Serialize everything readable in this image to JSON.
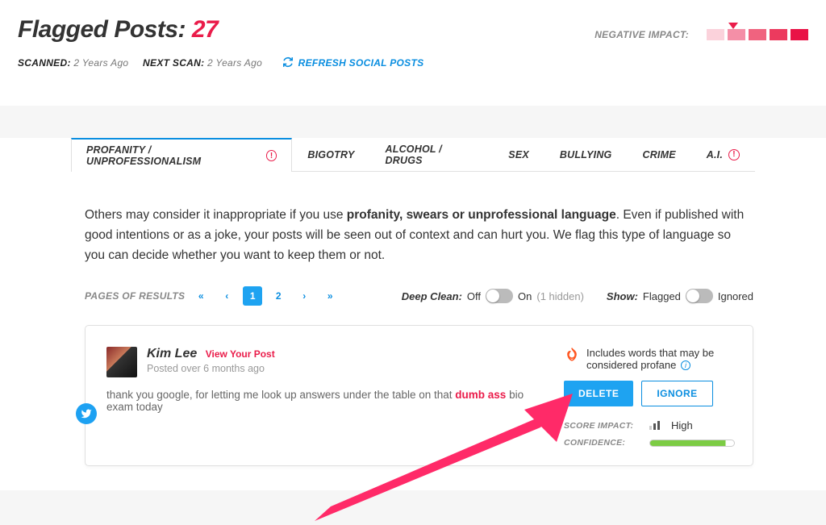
{
  "header": {
    "title_label": "Flagged Posts:",
    "count": "27",
    "scanned_label": "SCANNED:",
    "scanned_value": "2 Years Ago",
    "nextscan_label": "NEXT SCAN:",
    "nextscan_value": "2 Years Ago",
    "refresh": "REFRESH SOCIAL POSTS"
  },
  "impact": {
    "label": "NEGATIVE IMPACT:",
    "colors": [
      "#fbd2db",
      "#f48fa7",
      "#f0637f",
      "#ec3a5e",
      "#e91246"
    ],
    "pointer_index": 1
  },
  "tabs": [
    {
      "label": "PROFANITY / UNPROFESSIONALISM",
      "alert": true,
      "active": true
    },
    {
      "label": "BIGOTRY",
      "alert": false,
      "active": false
    },
    {
      "label": "ALCOHOL / DRUGS",
      "alert": false,
      "active": false
    },
    {
      "label": "SEX",
      "alert": false,
      "active": false
    },
    {
      "label": "BULLYING",
      "alert": false,
      "active": false
    },
    {
      "label": "CRIME",
      "alert": false,
      "active": false
    },
    {
      "label": "A.I.",
      "alert": true,
      "active": false
    }
  ],
  "description": {
    "pre": "Others may consider it inappropriate if you use ",
    "bold": "profanity, swears or unprofessional language",
    "post": ". Even if published with good intentions or as a joke, your posts will be seen out of context and can hurt you. We flag this type of language so you can decide whether you want to keep them or not."
  },
  "pager": {
    "label": "PAGES OF RESULTS",
    "pages": [
      "1",
      "2"
    ],
    "active": "1"
  },
  "controls": {
    "deepclean_label": "Deep Clean:",
    "off": "Off",
    "on": "On",
    "hidden": "(1 hidden)",
    "show_label": "Show:",
    "flagged": "Flagged",
    "ignored": "Ignored"
  },
  "post": {
    "name": "Kim Lee",
    "view_link": "View Your Post",
    "ago": "Posted over 6 months ago",
    "text_pre": "thank you google, for letting me look up answers under the table on that ",
    "flag_word": "dumb ass",
    "text_post": " bio exam today",
    "reason": "Includes words that may be considered profane",
    "delete": "DELETE",
    "ignore": "IGNORE",
    "score_label": "SCORE IMPACT:",
    "score_value": "High",
    "confidence_label": "CONFIDENCE:"
  }
}
